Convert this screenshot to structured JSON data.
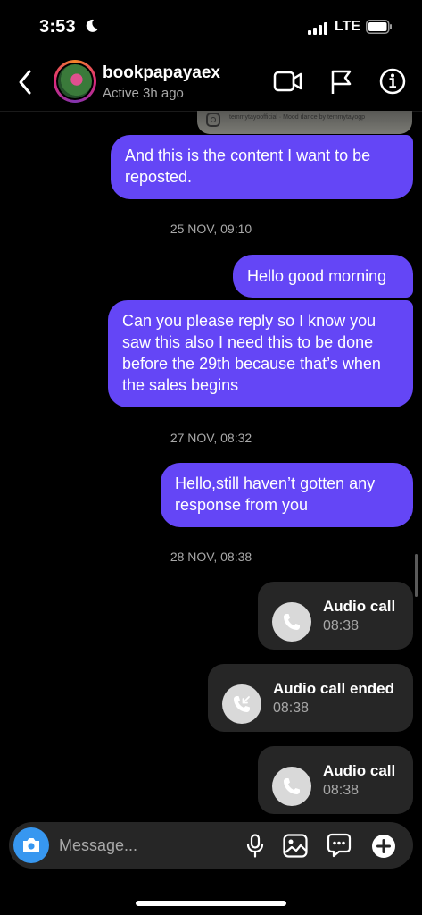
{
  "status_bar": {
    "time": "3:53",
    "network": "LTE"
  },
  "header": {
    "username": "bookpapayaex",
    "status": "Active 3h ago"
  },
  "shared_post": {
    "caption": "temmytayoofficial · Mood dance by temmytayogp"
  },
  "messages": [
    {
      "type": "text",
      "text": "And this is the content I want to be reposted."
    },
    {
      "type": "timestamp",
      "text": "25 NOV, 09:10"
    },
    {
      "type": "text",
      "text": "Hello good morning"
    },
    {
      "type": "text",
      "text": "Can you please reply so I know you saw this also I need this to be done before the 29th because that’s when the sales begins"
    },
    {
      "type": "timestamp",
      "text": "27 NOV, 08:32"
    },
    {
      "type": "text",
      "text": "Hello,still haven’t gotten any response from you"
    },
    {
      "type": "timestamp",
      "text": "28 NOV, 08:38"
    },
    {
      "type": "call",
      "title": "Audio call",
      "time": "08:38",
      "icon": "phone-icon"
    },
    {
      "type": "call",
      "title": "Audio call ended",
      "time": "08:38",
      "icon": "phone-callback-icon"
    },
    {
      "type": "call",
      "title": "Audio call",
      "time": "08:38",
      "icon": "phone-icon"
    }
  ],
  "composer": {
    "placeholder": "Message..."
  },
  "colors": {
    "bubble": "#6446f6",
    "call_card": "#262626",
    "camera_button": "#3797f0",
    "background": "#000000"
  }
}
